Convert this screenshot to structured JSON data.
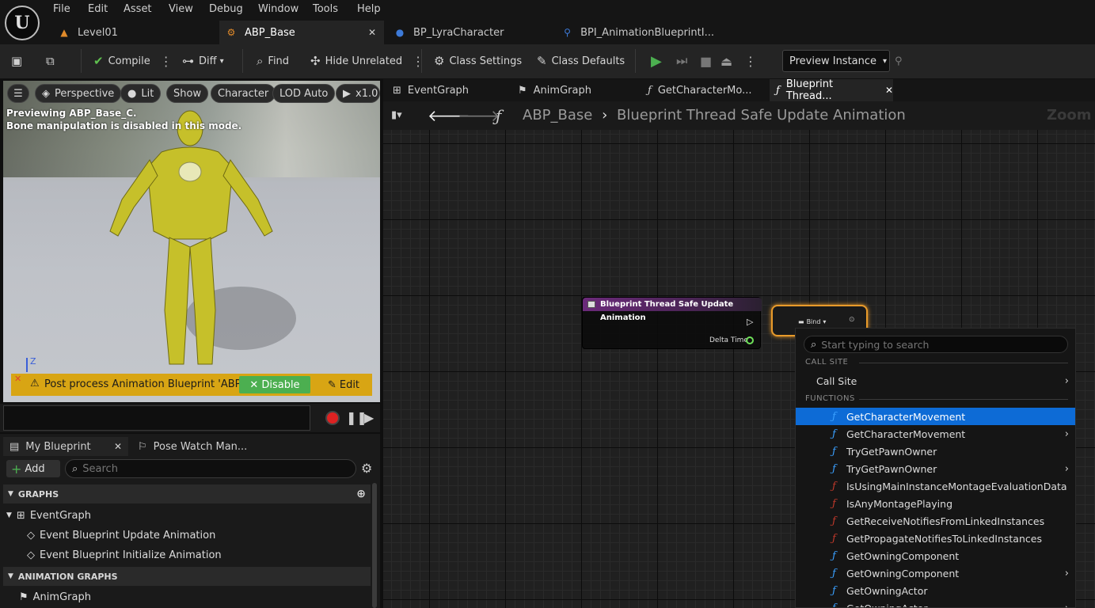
{
  "menu": [
    "File",
    "Edit",
    "Asset",
    "View",
    "Debug",
    "Window",
    "Tools",
    "Help"
  ],
  "doc_tabs": [
    "Level01",
    "ABP_Base",
    "BP_LyraCharacter",
    "BPI_AnimationBlueprintI..."
  ],
  "toolbar": {
    "compile": "Compile",
    "diff": "Diff",
    "find": "Find",
    "hide_unrelated": "Hide Unrelated",
    "class_settings": "Class Settings",
    "class_defaults": "Class Defaults",
    "preview_instance": "Preview Instance"
  },
  "viewport": {
    "perspective": "Perspective",
    "lit": "Lit",
    "show": "Show",
    "character": "Character",
    "lod": "LOD Auto",
    "speed": "x1.0",
    "line1": "Previewing ABP_Base_C.",
    "line2": "Bone manipulation is disabled in this mode.",
    "axis": "Z",
    "warning": "Post process Animation Blueprint 'ABP_Mannequin_PostProcess'",
    "disable": "Disable",
    "edit": "Edit"
  },
  "my_blueprint": {
    "tab1": "My Blueprint",
    "tab2": "Pose Watch Man...",
    "add": "Add",
    "search_placeholder": "Search",
    "graphs_header": "GRAPHS",
    "event_graph": "EventGraph",
    "event_update": "Event Blueprint Update Animation",
    "event_init": "Event Blueprint Initialize Animation",
    "anim_graphs_header": "ANIMATION GRAPHS",
    "anim_graph": "AnimGraph"
  },
  "graph_tabs": [
    "EventGraph",
    "AnimGraph",
    "GetCharacterMo...",
    "Blueprint Thread..."
  ],
  "breadcrumb": {
    "root": "ABP_Base",
    "current": "Blueprint Thread Safe Update Animation",
    "zoom": "Zoom -"
  },
  "node": {
    "title": "Blueprint Thread Safe Update Animation",
    "pin": "Delta Time",
    "bind": "Bind"
  },
  "dropdown": {
    "search_placeholder": "Start typing to search",
    "cat_call_site": "CALL SITE",
    "call_site": "Call Site",
    "cat_functions": "FUNCTIONS",
    "functions": [
      {
        "label": "GetCharacterMovement",
        "color": "#3aa0ff",
        "sub": false,
        "selected": true
      },
      {
        "label": "GetCharacterMovement",
        "color": "#3aa0ff",
        "sub": true,
        "selected": false
      },
      {
        "label": "TryGetPawnOwner",
        "color": "#3aa0ff",
        "sub": false,
        "selected": false
      },
      {
        "label": "TryGetPawnOwner",
        "color": "#3aa0ff",
        "sub": true,
        "selected": false
      },
      {
        "label": "IsUsingMainInstanceMontageEvaluationData",
        "color": "#c0392b",
        "sub": false,
        "selected": false
      },
      {
        "label": "IsAnyMontagePlaying",
        "color": "#c0392b",
        "sub": false,
        "selected": false
      },
      {
        "label": "GetReceiveNotifiesFromLinkedInstances",
        "color": "#c0392b",
        "sub": false,
        "selected": false
      },
      {
        "label": "GetPropagateNotifiesToLinkedInstances",
        "color": "#c0392b",
        "sub": false,
        "selected": false
      },
      {
        "label": "GetOwningComponent",
        "color": "#3aa0ff",
        "sub": false,
        "selected": false
      },
      {
        "label": "GetOwningComponent",
        "color": "#3aa0ff",
        "sub": true,
        "selected": false
      },
      {
        "label": "GetOwningActor",
        "color": "#3aa0ff",
        "sub": false,
        "selected": false
      },
      {
        "label": "GetOwningActor",
        "color": "#3aa0ff",
        "sub": true,
        "selected": false
      }
    ]
  }
}
